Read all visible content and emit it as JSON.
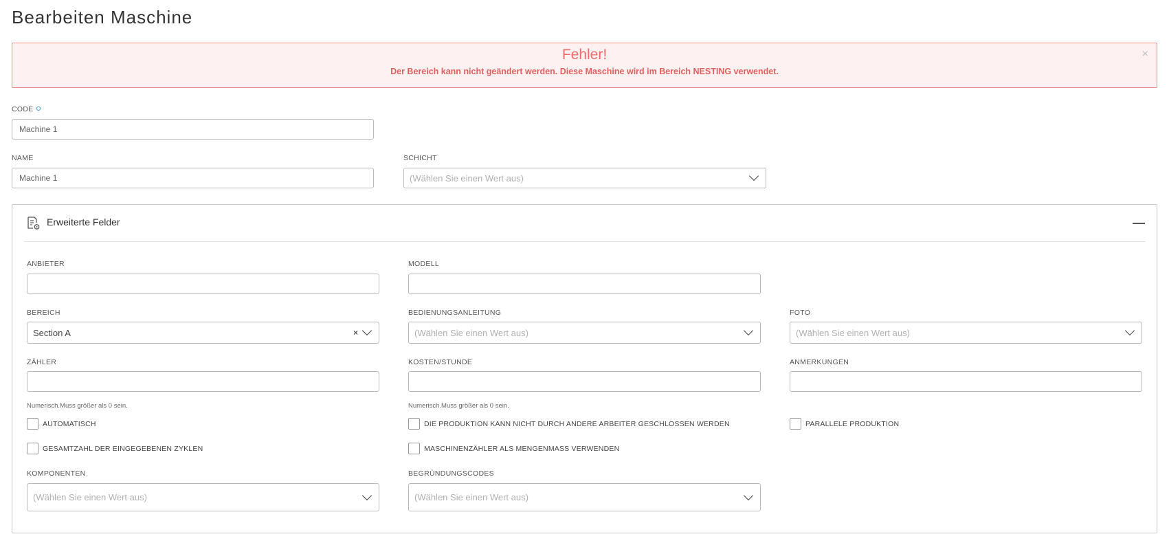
{
  "page": {
    "title": "Bearbeiten Maschine"
  },
  "alert": {
    "title": "Fehler!",
    "message": "Der Bereich kann nicht geändert werden. Diese Maschine wird im Bereich NESTING verwendet.",
    "close": "×"
  },
  "form": {
    "code": {
      "label": "CODE",
      "value": "Machine 1"
    },
    "name": {
      "label": "NAME",
      "value": "Machine 1"
    },
    "schicht": {
      "label": "SCHICHT",
      "placeholder": "(Wählen Sie einen Wert aus)"
    }
  },
  "extended": {
    "title": "Erweiterte Felder",
    "anbieter": {
      "label": "ANBIETER",
      "value": ""
    },
    "modell": {
      "label": "MODELL",
      "value": ""
    },
    "bereich": {
      "label": "BEREICH",
      "value": "Section A",
      "clear": "×"
    },
    "bedienungsanleitung": {
      "label": "BEDIENUNGSANLEITUNG",
      "placeholder": "(Wählen Sie einen Wert aus)"
    },
    "foto": {
      "label": "FOTO",
      "placeholder": "(Wählen Sie einen Wert aus)"
    },
    "zaehler": {
      "label": "ZÄHLER",
      "value": "",
      "hint": "Numerisch.Muss größer als 0 sein."
    },
    "kosten": {
      "label": "KOSTEN/STUNDE",
      "value": "",
      "hint": "Numerisch.Muss größer als 0 sein."
    },
    "anmerkungen": {
      "label": "ANMERKUNGEN",
      "value": ""
    },
    "checkboxes": {
      "automatisch": "AUTOMATISCH",
      "produktion": "DIE PRODUKTION KANN NICHT DURCH ANDERE ARBEITER GESCHLOSSEN WERDEN",
      "parallele": "PARALLELE PRODUKTION",
      "gesamtzahl": "GESAMTZAHL DER EINGEGEBENEN ZYKLEN",
      "maschinenzaehler": "MASCHINENZÄHLER ALS MENGENMASS VERWENDEN"
    },
    "komponenten": {
      "label": "KOMPONENTEN",
      "placeholder": "(Wählen Sie einen Wert aus)"
    },
    "begruendungscodes": {
      "label": "BEGRÜNDUNGSCODES",
      "placeholder": "(Wählen Sie einen Wert aus)"
    }
  },
  "icons": {
    "panel": "settings-document-icon",
    "collapse": "minus-icon",
    "chevron": "chevron-down-icon",
    "info": "info-dot-icon"
  }
}
